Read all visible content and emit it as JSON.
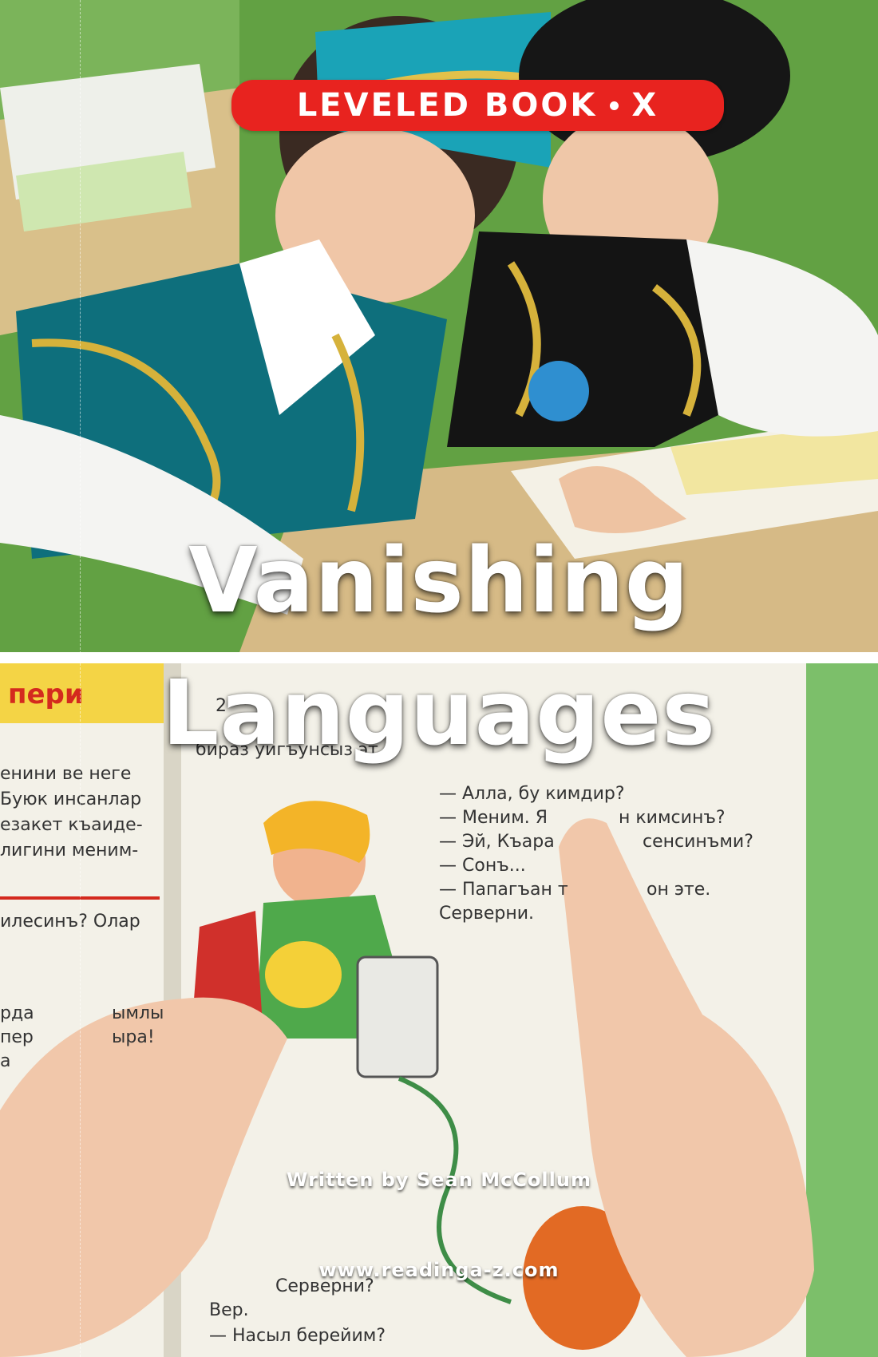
{
  "banner": {
    "series": "LEVELED BOOK",
    "level": "X",
    "bg_color": "#e8231f"
  },
  "title": {
    "line1": "Vanishing",
    "line2": "Languages"
  },
  "author": "Written by Sean McCollum",
  "website": "www.readinga-z.com",
  "book_text": {
    "left_heading": "пери",
    "left_lines": [
      "енини ве неге",
      "Буюк инсанлар",
      "езакет къаиде-",
      "лигини меним-",
      "илесинъ? Олар",
      "рда",
      "пер",
      "а",
      "ымлы",
      "ыра!"
    ],
    "right_lines": [
      "— Алла, бу кимдир?",
      "— Меним. Я",
      "н кимсинъ?",
      "— Эй, Къара",
      "сенсинъми?",
      "— Сонъ...",
      "— Папагъан т",
      "он эте.",
      "Серверни."
    ],
    "top_lines": [
      "2",
      "бираз уйгъунсыз эт..."
    ],
    "bottom_lines": [
      "Серверни?",
      "Вер.",
      "— Насыл берейим?"
    ]
  }
}
